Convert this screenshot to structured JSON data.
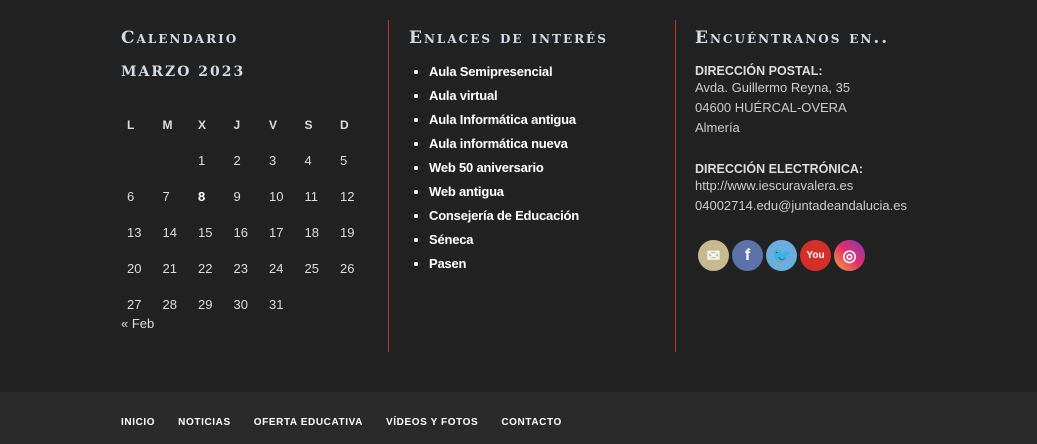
{
  "calendar": {
    "title": "Calendario",
    "caption": "MARZO 2023",
    "days": [
      "L",
      "M",
      "X",
      "J",
      "V",
      "S",
      "D"
    ],
    "weeks": [
      [
        "",
        "",
        "1",
        "2",
        "3",
        "4",
        "5"
      ],
      [
        "6",
        "7",
        "8",
        "9",
        "10",
        "11",
        "12"
      ],
      [
        "13",
        "14",
        "15",
        "16",
        "17",
        "18",
        "19"
      ],
      [
        "20",
        "21",
        "22",
        "23",
        "24",
        "25",
        "26"
      ],
      [
        "27",
        "28",
        "29",
        "30",
        "31",
        "",
        ""
      ]
    ],
    "today": "8",
    "prev": "« Feb"
  },
  "links": {
    "title": "Enlaces de interés",
    "items": [
      "Aula Semipresencial",
      "Aula virtual",
      "Aula Informática antigua",
      "Aula informática nueva",
      "Web 50 aniversario",
      "Web antigua",
      "Consejería de Educación",
      "Séneca",
      "Pasen"
    ]
  },
  "contact": {
    "title": "Encuéntranos en..",
    "postal_label": "DIRECCIÓN POSTAL:",
    "postal": [
      "Avda. Guillermo Reyna, 35",
      "04600 HUÉRCAL-OVERA",
      "Almería"
    ],
    "email_label": "DIRECCIÓN ELECTRÓNICA:",
    "electronic": [
      "http://www.iescuravalera.es",
      "04002714.edu@juntadeandalucia.es"
    ],
    "social": [
      {
        "icon": "email-icon",
        "glyph": "✉",
        "color": "#c8b98f"
      },
      {
        "icon": "facebook-icon",
        "glyph": "f",
        "color": "#5b73a8"
      },
      {
        "icon": "twitter-icon",
        "glyph": "🐦",
        "color": "#6aaedf"
      },
      {
        "icon": "youtube-icon",
        "glyph": "You",
        "color": "#d4302b"
      },
      {
        "icon": "instagram-icon",
        "glyph": "◎",
        "color": "#c13584"
      }
    ]
  },
  "footer_nav": [
    "INICIO",
    "NOTICIAS",
    "OFERTA EDUCATIVA",
    "VÍDEOS Y FOTOS",
    "CONTACTO"
  ]
}
